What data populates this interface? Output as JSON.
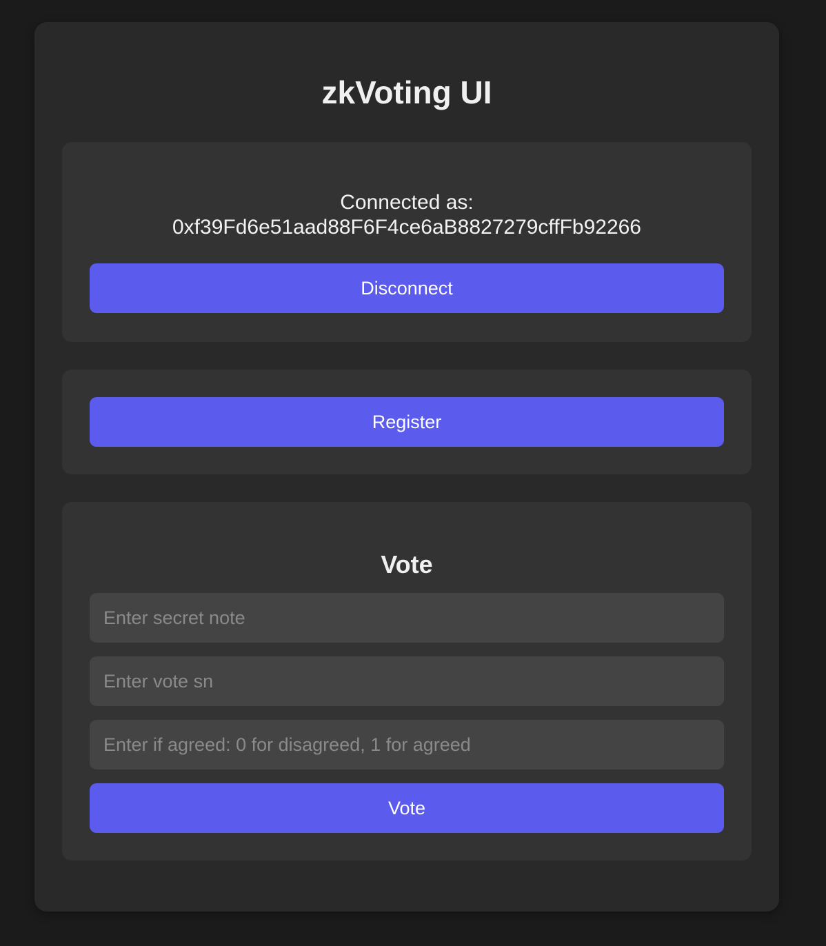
{
  "app": {
    "title": "zkVoting UI"
  },
  "connection": {
    "label": "Connected as:",
    "address": "0xf39Fd6e51aad88F6F4ce6aB8827279cffFb92266",
    "disconnect_label": "Disconnect"
  },
  "registration": {
    "register_label": "Register"
  },
  "vote": {
    "heading": "Vote",
    "secret_note_placeholder": "Enter secret note",
    "vote_sn_placeholder": "Enter vote sn",
    "agreed_placeholder": "Enter if agreed: 0 for disagreed, 1 for agreed",
    "submit_label": "Vote"
  },
  "colors": {
    "page_background": "#1b1b1b",
    "card_background": "#292929",
    "panel_background": "#333333",
    "input_background": "#444444",
    "accent": "#5b5bee"
  }
}
